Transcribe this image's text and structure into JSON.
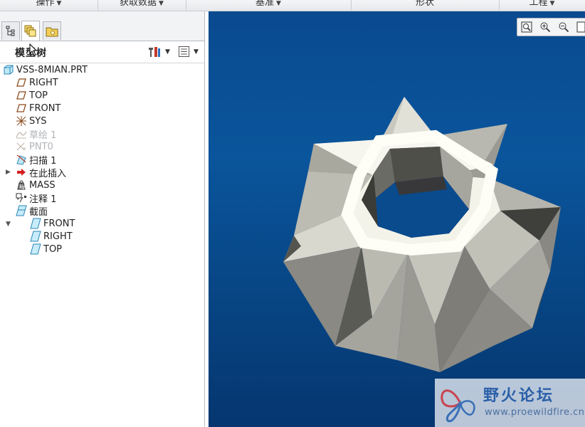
{
  "ribbon": {
    "groups": [
      {
        "label": "操作",
        "has_menu": true
      },
      {
        "label": "获取数据",
        "has_menu": true
      },
      {
        "label": "基准",
        "has_menu": true
      },
      {
        "label": "形状",
        "has_menu": false
      },
      {
        "label": "工程",
        "has_menu": true
      }
    ]
  },
  "panel": {
    "tabs": [
      "model-tree-tab",
      "layer-tree-tab",
      "folder-browser-tab"
    ],
    "tree_title": "模型树"
  },
  "tree": {
    "items": [
      {
        "label": "VSS-8MIAN.PRT",
        "icon": "part-icon",
        "state": "normal"
      },
      {
        "label": "RIGHT",
        "icon": "datum-plane-icon",
        "state": "normal"
      },
      {
        "label": "TOP",
        "icon": "datum-plane-icon",
        "state": "normal"
      },
      {
        "label": "FRONT",
        "icon": "datum-plane-icon",
        "state": "normal"
      },
      {
        "label": "SYS",
        "icon": "coordinate-system-icon",
        "state": "normal"
      },
      {
        "label": "草绘 1",
        "icon": "sketch-icon",
        "state": "hidden"
      },
      {
        "label": "PNT0",
        "icon": "datum-point-icon",
        "state": "hidden"
      },
      {
        "label": "扫描 1",
        "icon": "sweep-icon",
        "state": "normal"
      },
      {
        "label": "在此插入",
        "icon": "insert-here-icon",
        "state": "normal"
      },
      {
        "label": "MASS",
        "icon": "mass-properties-icon",
        "state": "normal"
      },
      {
        "label": "注释 1",
        "icon": "annotation-icon",
        "state": "normal"
      },
      {
        "label": "截面",
        "icon": "section-folder-icon",
        "state": "normal"
      },
      {
        "label": "FRONT",
        "icon": "section-icon",
        "state": "normal"
      },
      {
        "label": "RIGHT",
        "icon": "section-icon",
        "state": "normal"
      },
      {
        "label": "TOP",
        "icon": "section-icon",
        "state": "normal"
      }
    ]
  },
  "view_toolbar": [
    "zoom-fit-icon",
    "zoom-in-icon",
    "zoom-out-icon",
    "repaint-icon"
  ],
  "watermark": {
    "title": "野火论坛",
    "url": "www.proewildfire.cn"
  },
  "colors": {
    "viewport_top": "#0a4a8f",
    "viewport_bottom": "#053670",
    "model_light": "#f7f6ee",
    "model_mid": "#a7a79f",
    "model_dark": "#3d3d39"
  }
}
